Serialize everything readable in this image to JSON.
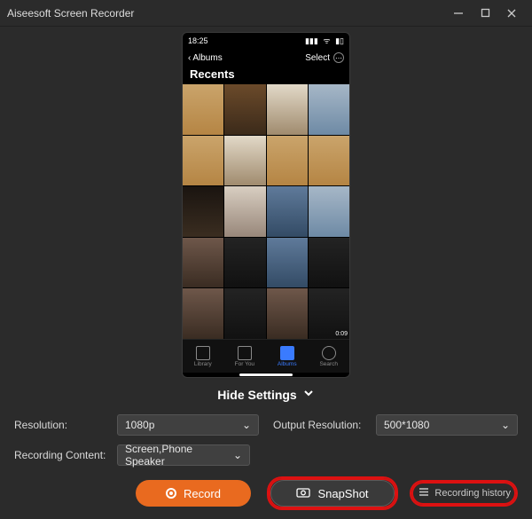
{
  "window": {
    "title": "Aiseesoft Screen Recorder"
  },
  "phone": {
    "time": "18:25",
    "back_label": "Albums",
    "title": "Recents",
    "select_label": "Select",
    "video_duration": "0:09",
    "tabs": [
      {
        "label": "Library",
        "active": false
      },
      {
        "label": "For You",
        "active": false
      },
      {
        "label": "Albums",
        "active": true
      },
      {
        "label": "Search",
        "active": false
      }
    ]
  },
  "hide_settings": {
    "label": "Hide Settings"
  },
  "settings": {
    "resolution_label": "Resolution:",
    "resolution_value": "1080p",
    "output_label": "Output Resolution:",
    "output_value": "500*1080",
    "content_label": "Recording Content:",
    "content_value": "Screen,Phone Speaker"
  },
  "actions": {
    "record_label": "Record",
    "snapshot_label": "SnapShot",
    "history_label": "Recording history"
  }
}
